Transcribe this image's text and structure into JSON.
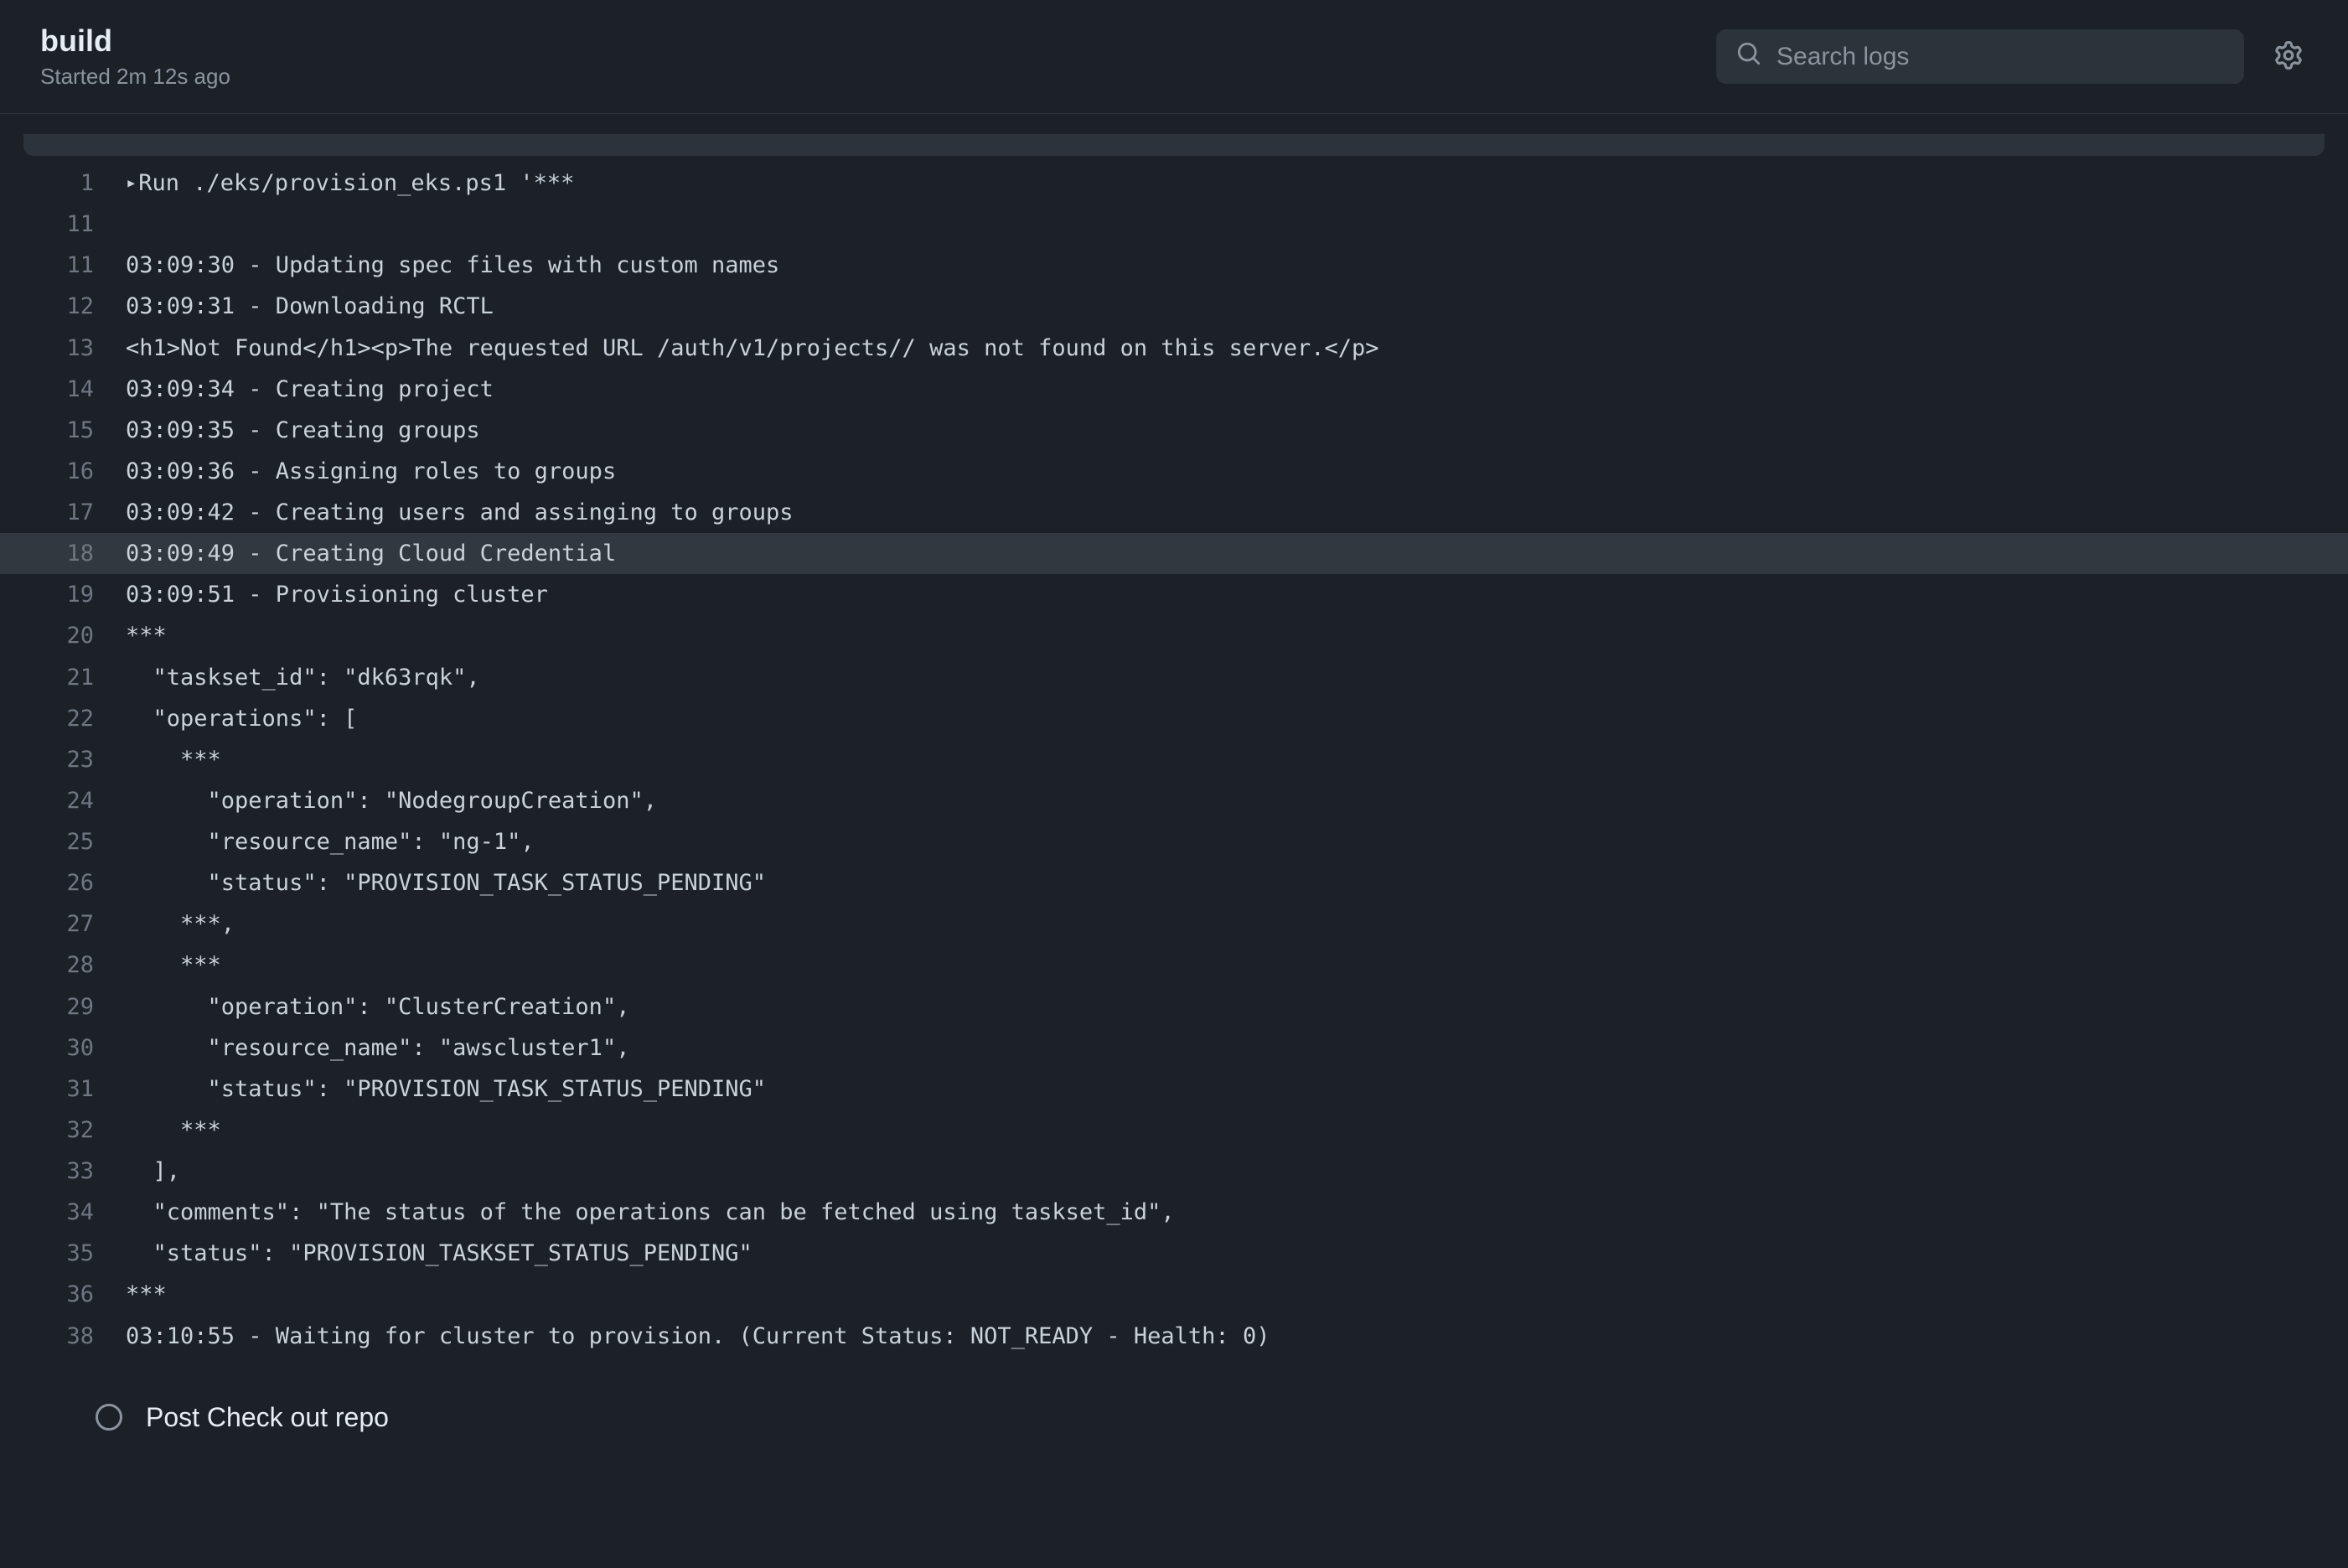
{
  "header": {
    "title": "build",
    "subtitle": "Started 2m 12s ago",
    "search_placeholder": "Search logs"
  },
  "lines": [
    {
      "num": "1",
      "text": "Run ./eks/provision_eks.ps1 '***",
      "disclosure": true
    },
    {
      "num": "11",
      "text": ""
    },
    {
      "num": "11",
      "text": "03:09:30 - Updating spec files with custom names"
    },
    {
      "num": "12",
      "text": "03:09:31 - Downloading RCTL"
    },
    {
      "num": "13",
      "text": "<h1>Not Found</h1><p>The requested URL /auth/v1/projects// was not found on this server.</p>"
    },
    {
      "num": "14",
      "text": "03:09:34 - Creating project"
    },
    {
      "num": "15",
      "text": "03:09:35 - Creating groups"
    },
    {
      "num": "16",
      "text": "03:09:36 - Assigning roles to groups"
    },
    {
      "num": "17",
      "text": "03:09:42 - Creating users and assinging to groups"
    },
    {
      "num": "18",
      "text": "03:09:49 - Creating Cloud Credential",
      "highlighted": true
    },
    {
      "num": "19",
      "text": "03:09:51 - Provisioning cluster"
    },
    {
      "num": "20",
      "text": "***"
    },
    {
      "num": "21",
      "text": "  \"taskset_id\": \"dk63rqk\","
    },
    {
      "num": "22",
      "text": "  \"operations\": ["
    },
    {
      "num": "23",
      "text": "    ***"
    },
    {
      "num": "24",
      "text": "      \"operation\": \"NodegroupCreation\","
    },
    {
      "num": "25",
      "text": "      \"resource_name\": \"ng-1\","
    },
    {
      "num": "26",
      "text": "      \"status\": \"PROVISION_TASK_STATUS_PENDING\""
    },
    {
      "num": "27",
      "text": "    ***,"
    },
    {
      "num": "28",
      "text": "    ***"
    },
    {
      "num": "29",
      "text": "      \"operation\": \"ClusterCreation\","
    },
    {
      "num": "30",
      "text": "      \"resource_name\": \"awscluster1\","
    },
    {
      "num": "31",
      "text": "      \"status\": \"PROVISION_TASK_STATUS_PENDING\""
    },
    {
      "num": "32",
      "text": "    ***"
    },
    {
      "num": "33",
      "text": "  ],"
    },
    {
      "num": "34",
      "text": "  \"comments\": \"The status of the operations can be fetched using taskset_id\","
    },
    {
      "num": "35",
      "text": "  \"status\": \"PROVISION_TASKSET_STATUS_PENDING\""
    },
    {
      "num": "36",
      "text": "***"
    },
    {
      "num": "38",
      "text": "03:10:55 - Waiting for cluster to provision. (Current Status: NOT_READY - Health: 0)"
    }
  ],
  "next_step": {
    "label": "Post Check out repo"
  }
}
